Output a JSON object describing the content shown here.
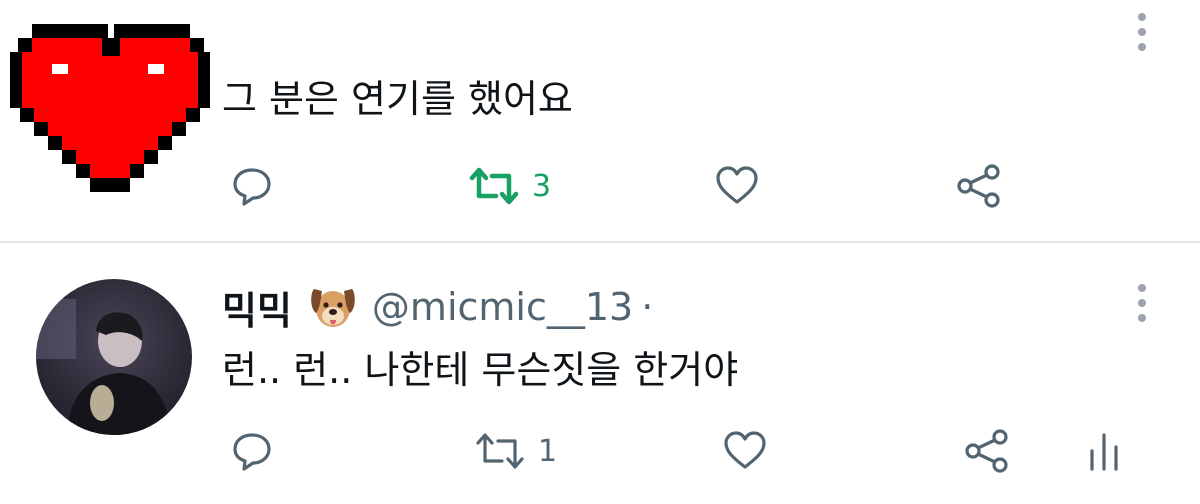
{
  "tweet1": {
    "text": "그 분은 연기를 했어요",
    "actions": {
      "retweet_count": "3"
    },
    "colors": {
      "heart": "#ff0000",
      "retweet_active": "#19a065"
    }
  },
  "tweet2": {
    "display_name": "믹믹",
    "handle": "@micmic__13",
    "separator": "·",
    "text": "런.. 런.. 나한테 무슨짓을 한거야",
    "actions": {
      "retweet_count": "1"
    }
  },
  "icons": {
    "reply": "reply-icon",
    "retweet": "retweet-icon",
    "like": "like-icon",
    "share": "share-icon",
    "analytics": "analytics-icon",
    "more": "more-icon"
  },
  "colors": {
    "icon": "#536471",
    "divider": "#e6e6e6",
    "text": "#0f1419"
  }
}
